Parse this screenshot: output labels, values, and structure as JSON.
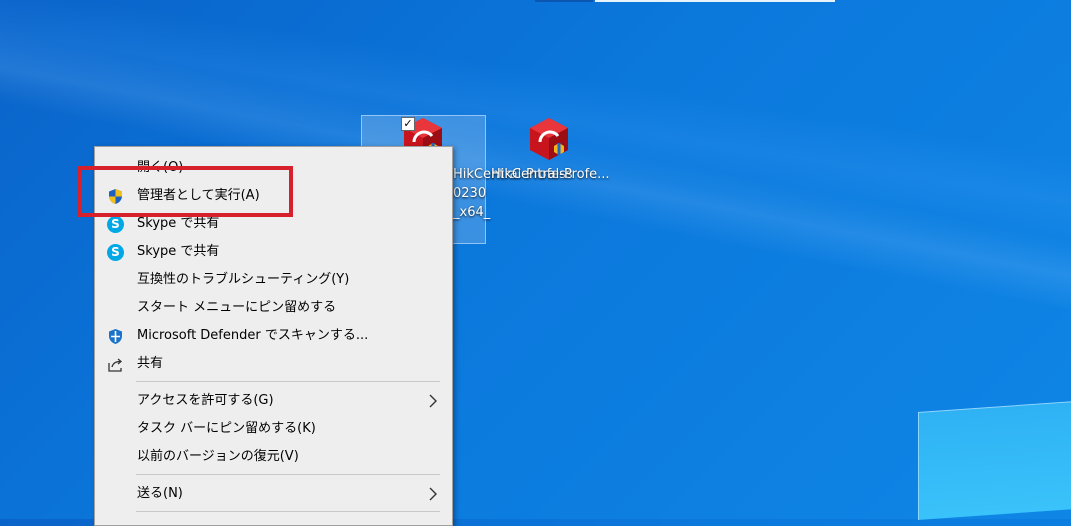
{
  "desktop": {
    "icons": [
      {
        "label_lines": [
          "HikCentral-Profess",
          "0230",
          "_x64_"
        ],
        "selected": true
      },
      {
        "label_lines": [
          "HikCentral-Profe..."
        ],
        "selected": false
      }
    ]
  },
  "context_menu": {
    "items": [
      {
        "label": "開く(O)",
        "icon": null
      },
      {
        "label": "管理者として実行(A)",
        "icon": "uac-shield-icon"
      },
      {
        "label": "Skype で共有",
        "icon": "skype-icon"
      },
      {
        "label": "Skype で共有",
        "icon": "skype-icon"
      },
      {
        "label": "互換性のトラブルシューティング(Y)",
        "icon": null
      },
      {
        "label": "スタート メニューにピン留めする",
        "icon": null
      },
      {
        "label": "Microsoft Defender でスキャンする...",
        "icon": "defender-shield-icon"
      },
      {
        "label": "共有",
        "icon": "share-icon"
      },
      {
        "label": "アクセスを許可する(G)",
        "icon": null,
        "submenu": true
      },
      {
        "label": "タスク バーにピン留めする(K)",
        "icon": null
      },
      {
        "label": "以前のバージョンの復元(V)",
        "icon": null
      },
      {
        "label": "送る(N)",
        "icon": null,
        "submenu": true
      }
    ]
  },
  "annotation": {
    "highlight_color": "#d6202c"
  },
  "colors": {
    "desktop_blue": "#0b78dc",
    "menu_bg": "#eeeeee"
  }
}
